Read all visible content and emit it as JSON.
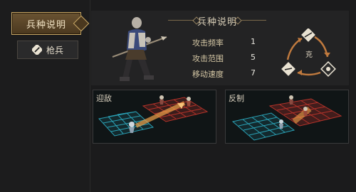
{
  "sidebar": {
    "main_tab_label": "兵种说明",
    "unit_tab_label": "枪兵",
    "unit_tab_icon": "spear-icon"
  },
  "panel": {
    "title": "兵种说明",
    "stats": [
      {
        "label": "攻击频率",
        "value": "1"
      },
      {
        "label": "攻击范围",
        "value": "5"
      },
      {
        "label": "移动速度",
        "value": "7"
      }
    ],
    "cycle_center_char": "克",
    "cycle_icons": [
      "spear-unit-icon",
      "archer-unit-icon",
      "cavalry-unit-icon"
    ]
  },
  "demos": [
    {
      "title": "迎敌"
    },
    {
      "title": "反制"
    }
  ],
  "colors": {
    "accent": "#c9a866",
    "friendly_grid": "#2aa0b4",
    "enemy_grid": "#b5332a"
  }
}
